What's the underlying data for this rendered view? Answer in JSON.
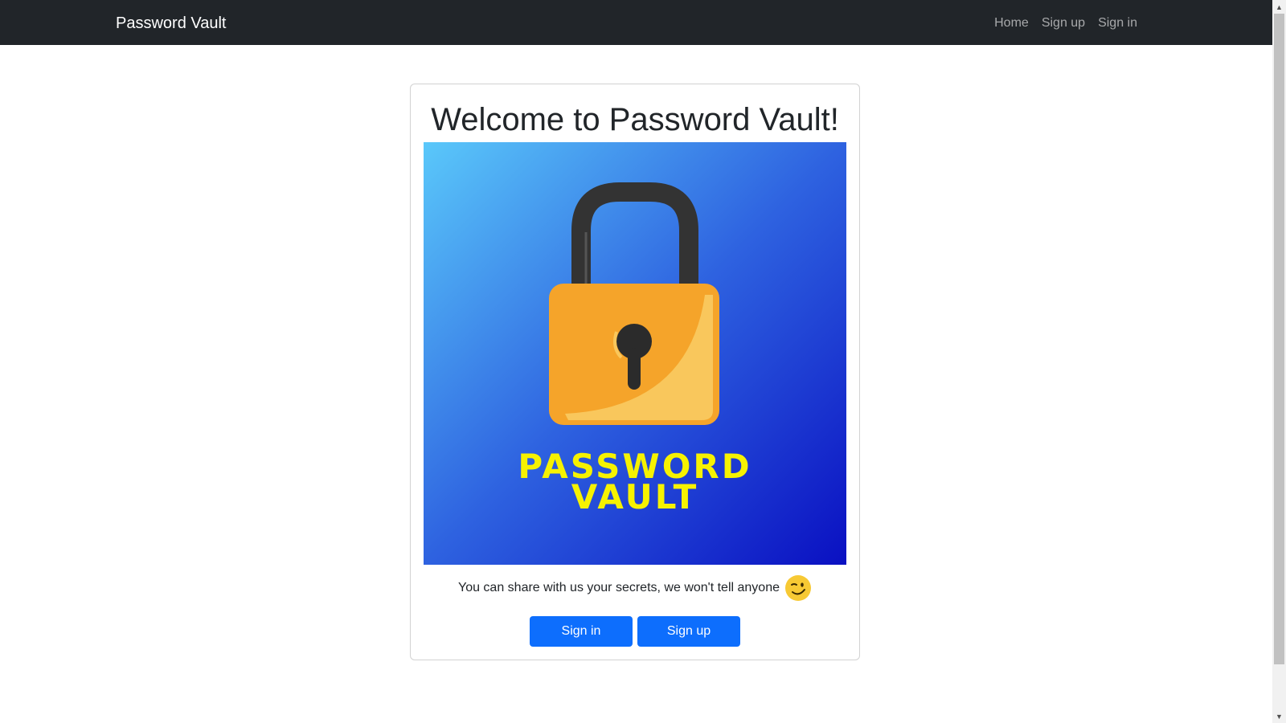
{
  "navbar": {
    "brand": "Password Vault",
    "links": [
      {
        "label": "Home"
      },
      {
        "label": "Sign up"
      },
      {
        "label": "Sign in"
      }
    ]
  },
  "card": {
    "title": "Welcome to Password Vault!",
    "hero": {
      "line1": "PASSWORD",
      "line2": "VAULT",
      "icon": "padlock",
      "text_color": "#f6f200"
    },
    "tagline": "You can share with us your secrets, we won't tell anyone",
    "emoji": "winking-face",
    "buttons": {
      "sign_in": "Sign in",
      "sign_up": "Sign up"
    }
  },
  "colors": {
    "navbar_bg": "#212529",
    "primary": "#0d6efd",
    "hero_gradient_start": "#5ac8fa",
    "hero_gradient_end": "#0a14c4",
    "lock_body": "#f5a42a",
    "lock_shackle": "#333333"
  }
}
